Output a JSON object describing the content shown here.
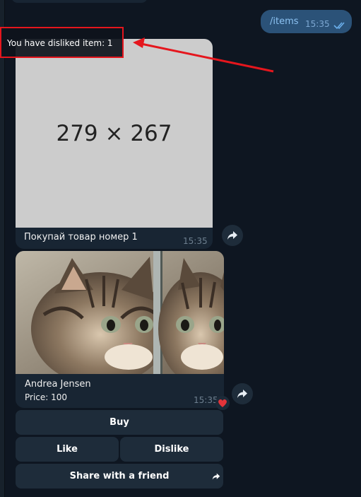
{
  "outgoing": {
    "text": "/items",
    "time": "15:35"
  },
  "photo_message": {
    "placeholder_text": "279 × 267",
    "caption": "Покупай товар номер 1",
    "time": "15:35"
  },
  "notice": {
    "text": "You have disliked item: 1"
  },
  "cat_message": {
    "name": "Andrea Jensen",
    "price": "Price: 100",
    "time": "15:35"
  },
  "keyboard": {
    "buy": "Buy",
    "like": "Like",
    "dislike": "Dislike",
    "share": "Share with a friend"
  },
  "colors": {
    "background": "#0e1621",
    "incoming_bubble": "#182533",
    "outgoing_bubble": "#2b5278",
    "annotation": "#e5161d"
  },
  "icons": [
    "double-check-icon",
    "forward-icon",
    "heart-reaction-icon",
    "share-arrow-icon"
  ]
}
